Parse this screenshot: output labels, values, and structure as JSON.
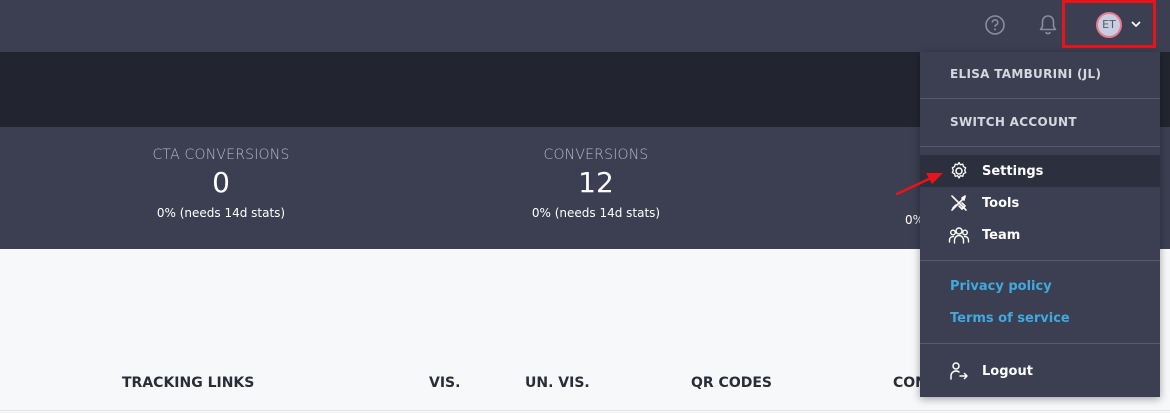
{
  "header": {
    "help_icon": "help-circle-icon",
    "bell_icon": "bell-icon",
    "avatar_initials": "ET",
    "highlight_color": "#e8141c"
  },
  "stats": [
    {
      "label": "CTA CONVERSIONS",
      "value": "0",
      "sub": "0% (needs 14d stats)"
    },
    {
      "label": "CONVERSIONS",
      "value": "12",
      "sub": "0% (needs 14d stats)"
    },
    {
      "label": "",
      "value": "",
      "sub": "0%"
    }
  ],
  "table": {
    "headers": [
      "TRACKING LINKS",
      "VIS.",
      "UN. VIS.",
      "QR CODES",
      "CON"
    ]
  },
  "menu": {
    "user_name": "ELISA TAMBURINI (JL)",
    "switch_account": "SWITCH ACCOUNT",
    "items": [
      {
        "label": "Settings",
        "icon": "gear-icon",
        "active": true
      },
      {
        "label": "Tools",
        "icon": "tools-icon",
        "active": false
      },
      {
        "label": "Team",
        "icon": "team-icon",
        "active": false
      }
    ],
    "links": [
      {
        "label": "Privacy policy"
      },
      {
        "label": "Terms of service"
      }
    ],
    "logout": {
      "label": "Logout",
      "icon": "logout-icon"
    }
  },
  "colors": {
    "topbar": "#3b3f51",
    "band": "#22242f",
    "link": "#3fa9e0",
    "arrow": "#e8141c"
  }
}
